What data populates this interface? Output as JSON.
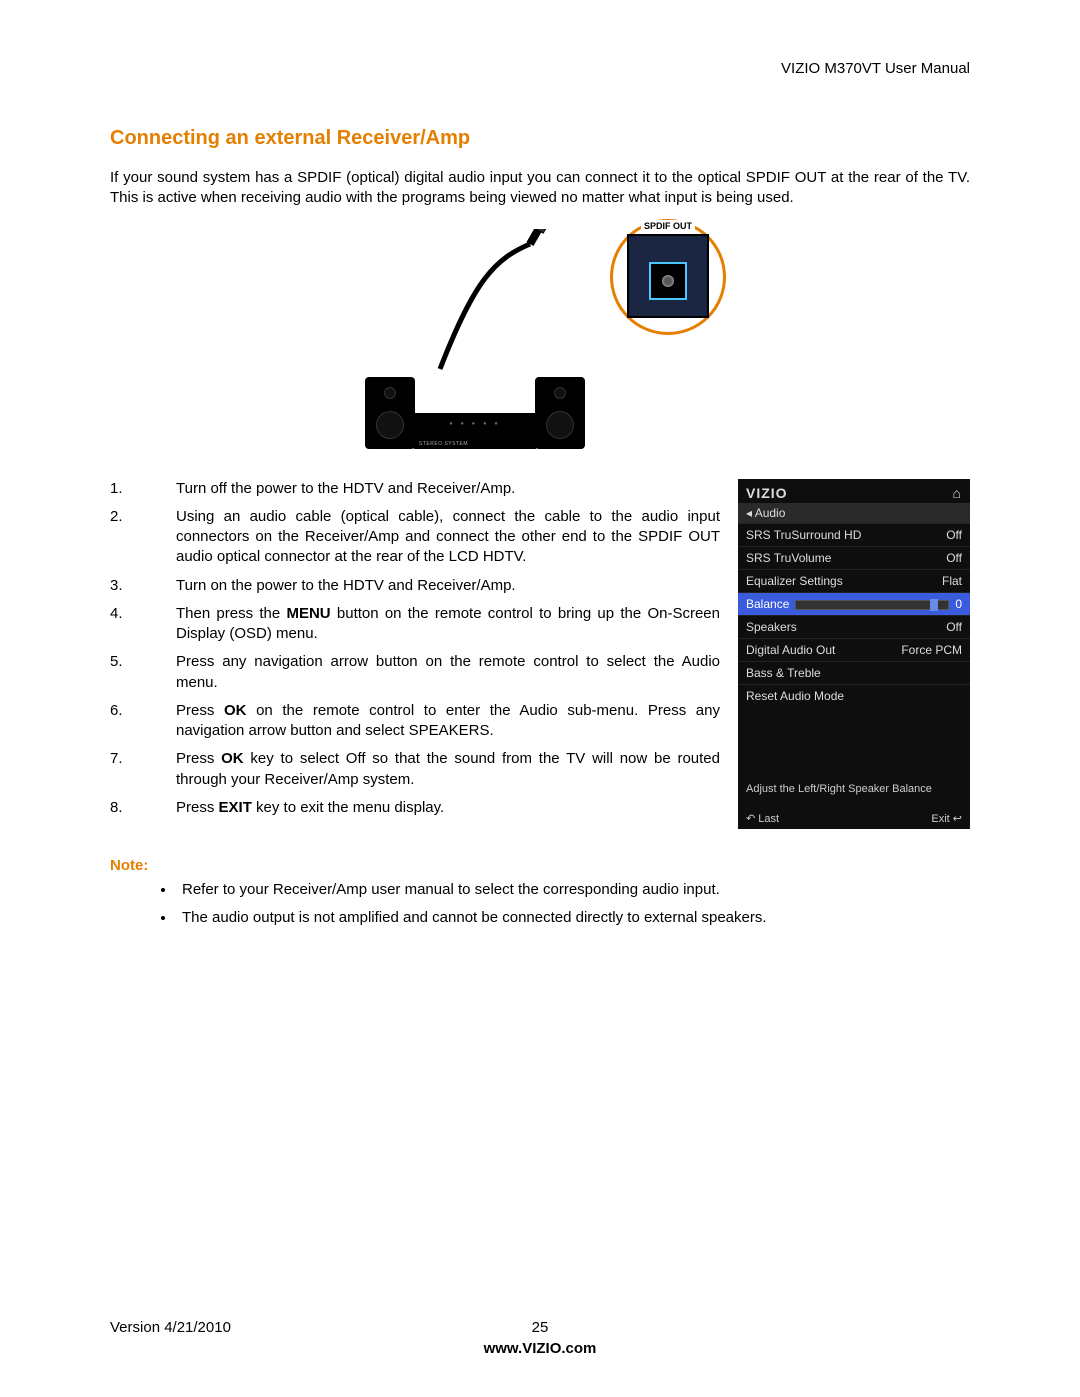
{
  "header": {
    "doc_title": "VIZIO M370VT User Manual"
  },
  "section": {
    "title": "Connecting an external Receiver/Amp"
  },
  "intro": "If your sound system has a SPDIF (optical) digital audio input you can connect it to the optical  SPDIF OUT at the rear of the TV.  This is active when receiving audio with the programs being viewed no matter what input is being used.",
  "figure": {
    "spdif_label": "SPDIF OUT",
    "amp_label": "STEREO SYSTEM"
  },
  "steps": [
    {
      "pre": "Turn off the power to the HDTV and Receiver/Amp."
    },
    {
      "pre": "Using an audio cable (optical cable), connect the cable to the audio input connectors on the Receiver/Amp and connect the other end to the SPDIF OUT  audio optical connector at the rear of the LCD HDTV."
    },
    {
      "pre": "Turn on the power to the HDTV and Receiver/Amp."
    },
    {
      "pre": "Then press the ",
      "bold": "MENU",
      "post": " button on the remote control to bring up the On-Screen Display (OSD) menu."
    },
    {
      "pre": "Press any navigation arrow button on the remote control to select the Audio menu."
    },
    {
      "pre": "Press ",
      "bold": "OK",
      "post": " on the remote control to enter the Audio sub-menu. Press any navigation arrow button and select SPEAKERS."
    },
    {
      "pre": "Press ",
      "bold": "OK",
      "post": " key to select Off so that the sound from the TV will now be routed through your Receiver/Amp system."
    },
    {
      "pre": "Press ",
      "bold": "EXIT",
      "post": " key to exit the menu display."
    }
  ],
  "osd": {
    "brand": "VIZIO",
    "menu": "Audio",
    "rows": [
      {
        "label": "SRS TruSurround HD",
        "value": "Off"
      },
      {
        "label": "SRS TruVolume",
        "value": "Off"
      },
      {
        "label": "Equalizer Settings",
        "value": "Flat"
      },
      {
        "label": "Balance",
        "value": "0",
        "slider": true,
        "selected": true
      },
      {
        "label": "Speakers",
        "value": "Off"
      },
      {
        "label": "Digital Audio Out",
        "value": "Force PCM"
      },
      {
        "label": "Bass & Treble",
        "value": ""
      },
      {
        "label": "Reset Audio Mode",
        "value": ""
      }
    ],
    "help": "Adjust the Left/Right Speaker Balance",
    "foot_left": "Last",
    "foot_right": "Exit"
  },
  "notes": {
    "label": "Note:",
    "items": [
      "Refer to your Receiver/Amp user manual to select the corresponding audio input.",
      "The audio output is not amplified and cannot be connected directly to external speakers."
    ]
  },
  "footer": {
    "version": "Version 4/21/2010",
    "page": "25",
    "url": "www.VIZIO.com"
  }
}
